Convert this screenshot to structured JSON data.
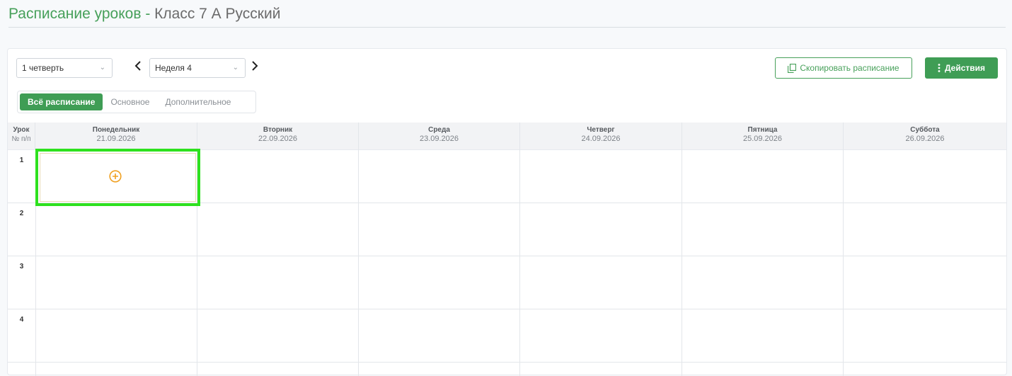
{
  "title": {
    "main": "Расписание уроков",
    "separator": " - ",
    "class_name": "Класс 7 А Русский"
  },
  "toolbar": {
    "quarter_select": "1 четверть",
    "week_select": "Неделя 4",
    "copy_button": "Скопировать расписание",
    "actions_button": "Действия"
  },
  "tabs": [
    {
      "label": "Всё расписание",
      "active": true
    },
    {
      "label": "Основное",
      "active": false
    },
    {
      "label": "Дополнительное",
      "active": false
    }
  ],
  "grid": {
    "lesson_header": {
      "line1": "Урок",
      "line2": "№ п/п"
    },
    "days": [
      {
        "name": "Понедельник",
        "date": "21.09.2026"
      },
      {
        "name": "Вторник",
        "date": "22.09.2026"
      },
      {
        "name": "Среда",
        "date": "23.09.2026"
      },
      {
        "name": "Четверг",
        "date": "24.09.2026"
      },
      {
        "name": "Пятница",
        "date": "25.09.2026"
      },
      {
        "name": "Суббота",
        "date": "26.09.2026"
      }
    ],
    "lessons": [
      "1",
      "2",
      "3",
      "4"
    ]
  },
  "icons": {
    "prev": "chevron-left-icon",
    "next": "chevron-right-icon",
    "copy": "copy-icon",
    "actions": "kebab-vertical-icon",
    "add": "plus-circle-icon"
  },
  "colors": {
    "accent": "#3f9d55",
    "highlight": "#2ee11e",
    "add_icon": "#f0a020"
  }
}
